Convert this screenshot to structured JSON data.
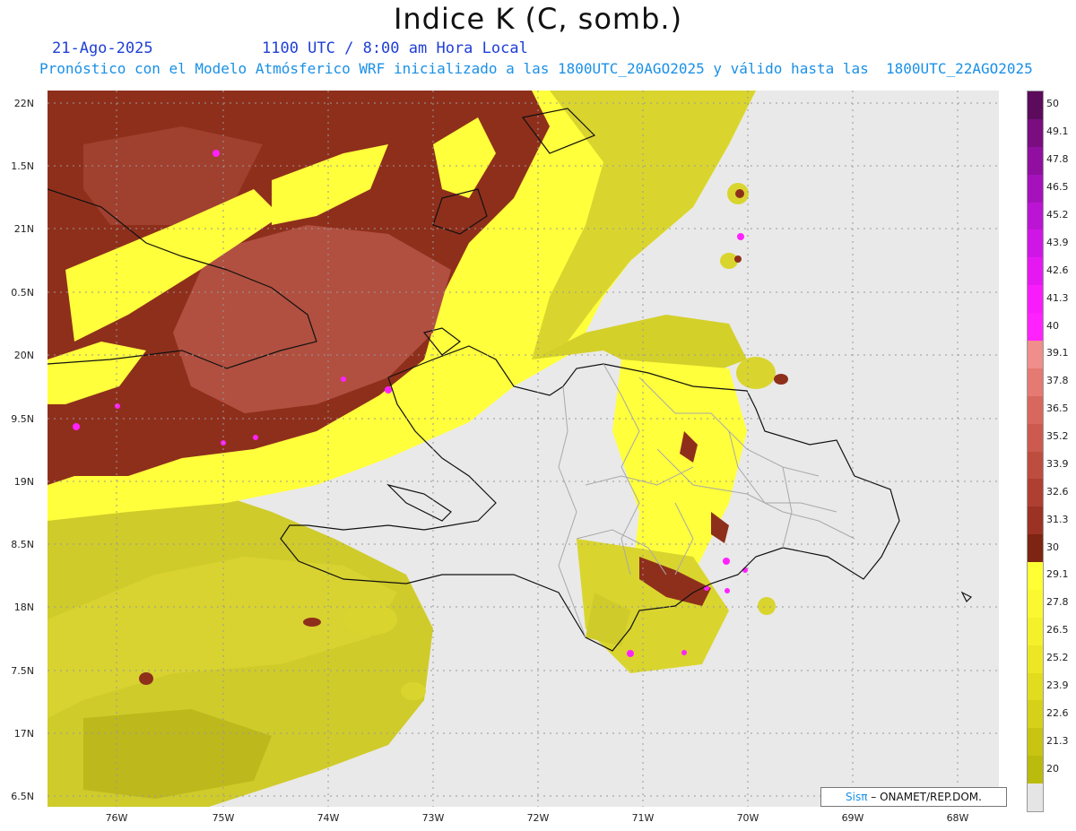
{
  "header": {
    "title": "Indice K (C, somb.)",
    "date": "21-Ago-2025",
    "time": "1100 UTC / 8:00 am Hora Local",
    "forecast": "Pronóstico con el Modelo Atmósferico WRF inicializado a las 1800UTC_20AGO2025 y válido hasta las  1800UTC_22AGO2025"
  },
  "axes": {
    "y": [
      "22N",
      "1.5N",
      "21N",
      "0.5N",
      "20N",
      "9.5N",
      "19N",
      "8.5N",
      "18N",
      "7.5N",
      "17N",
      "6.5N"
    ],
    "x": [
      "76W",
      "75W",
      "74W",
      "73W",
      "72W",
      "71W",
      "70W",
      "69W",
      "68W"
    ]
  },
  "colorbar": {
    "labels": [
      "50",
      "49.1",
      "47.8",
      "46.5",
      "45.2",
      "43.9",
      "42.6",
      "41.3",
      "40",
      "39.1",
      "37.8",
      "36.5",
      "35.2",
      "33.9",
      "32.6",
      "31.3",
      "30",
      "29.1",
      "27.8",
      "26.5",
      "25.2",
      "23.9",
      "22.6",
      "21.3",
      "20"
    ],
    "colors": [
      "#5c0a5c",
      "#7a0d80",
      "#900fa0",
      "#a512bc",
      "#bc14d4",
      "#d016e6",
      "#e618f2",
      "#f81cfc",
      "#ff22ff",
      "#ef8e8a",
      "#e47a72",
      "#d8685e",
      "#cc5a4f",
      "#bd4d3f",
      "#ae3f31",
      "#9c3223",
      "#7e2412",
      "#ffff33",
      "#fbf830",
      "#f4f02a",
      "#ece624",
      "#e2dc1e",
      "#d6d018",
      "#c9c312",
      "#babb0c",
      "#e5e5e5"
    ]
  },
  "map_colors": {
    "background": "#e9e9e9",
    "yellow": "#ffff3c",
    "olive": "#cfcb2a",
    "olive_dark": "#b9b519",
    "brown": "#8e2f1c",
    "brown_light": "#b95a46",
    "magenta": "#ff22ff",
    "coast": "#111111",
    "province_lines": "#a9a9a9",
    "grid": "#999999"
  },
  "credit": {
    "logo": "Sisπ",
    "text": "– ONAMET/REP.DOM."
  }
}
